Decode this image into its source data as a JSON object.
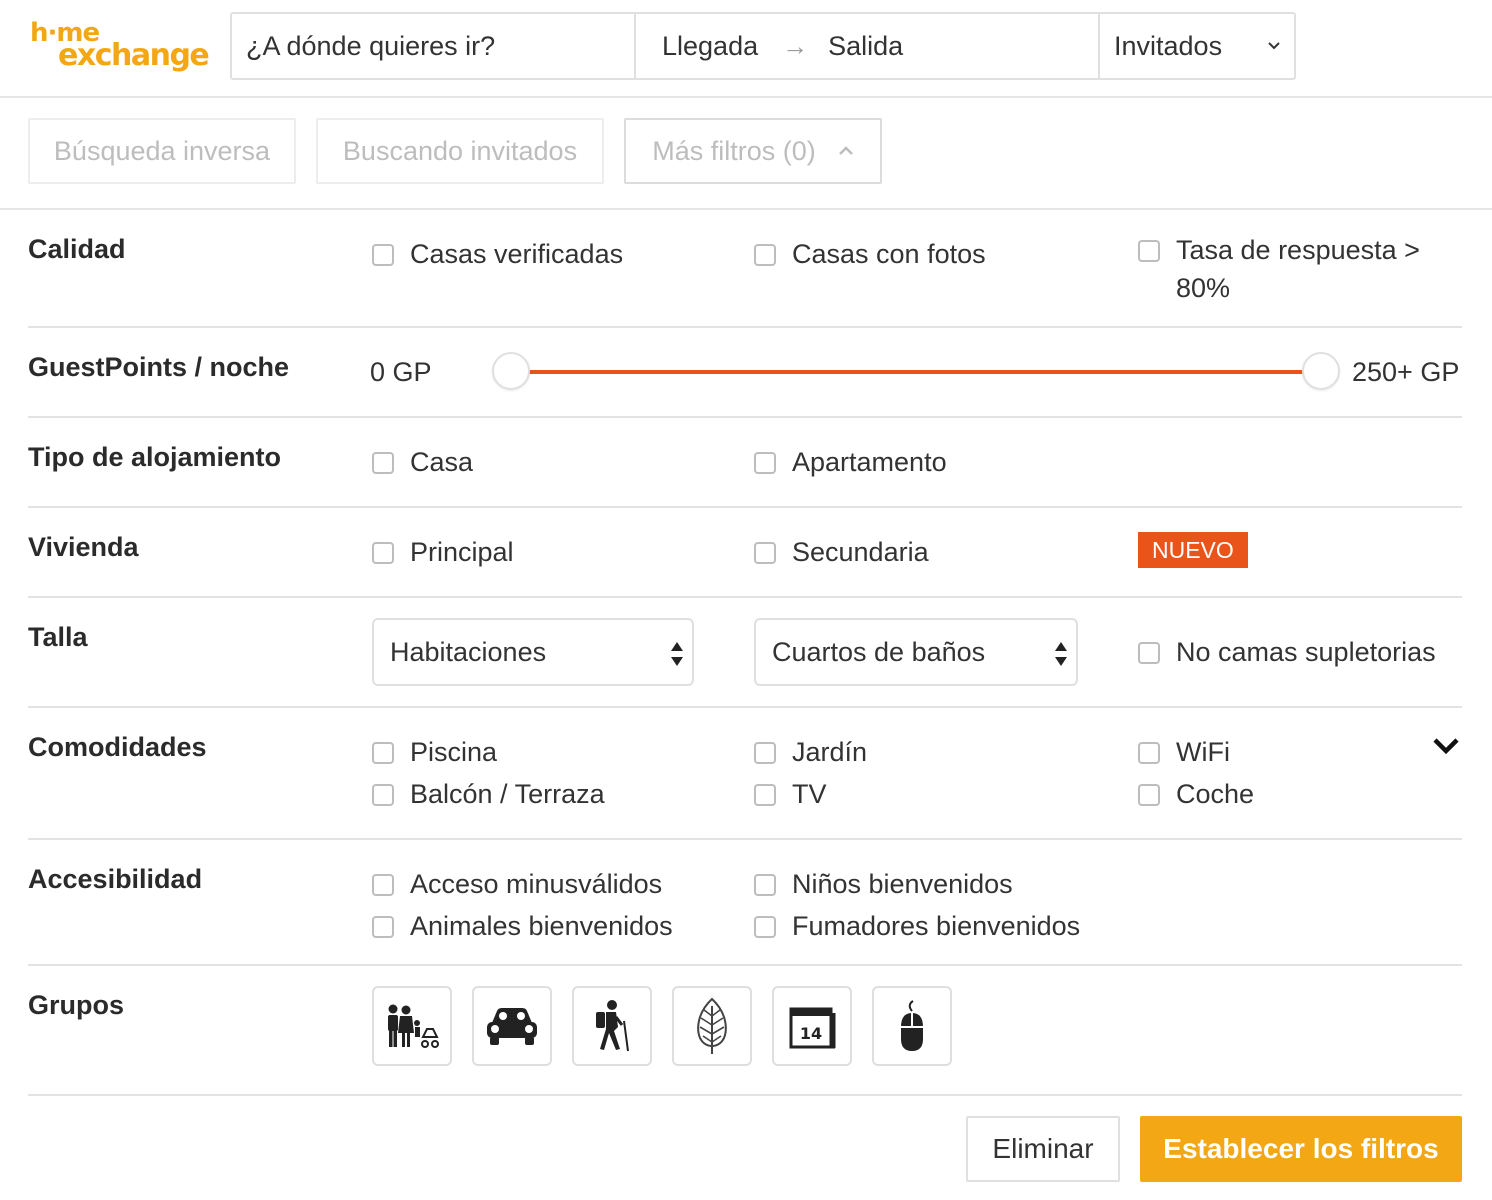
{
  "header": {
    "logo_line1": "h·me",
    "logo_line2": "exchange",
    "search_placeholder": "¿A dónde quieres ir?",
    "arrival": "Llegada",
    "arrow": "→",
    "departure": "Salida",
    "guests": "Invitados"
  },
  "quick_filters": {
    "reverse_search": "Búsqueda inversa",
    "looking_guests": "Buscando invitados",
    "more_filters": "Más filtros (0)"
  },
  "filters": {
    "quality": {
      "title": "Calidad",
      "options": [
        "Casas verificadas",
        "Casas con fotos",
        "Tasa de respuesta > 80%"
      ],
      "option3_line1": "Tasa de respuesta >",
      "option3_line2": "80%"
    },
    "guestpoints": {
      "title": "GuestPoints / noche",
      "min_label": "0 GP",
      "max_label": "250+ GP"
    },
    "accommodation_type": {
      "title": "Tipo de alojamiento",
      "options": [
        "Casa",
        "Apartamento"
      ]
    },
    "residence": {
      "title": "Vivienda",
      "options": [
        "Principal",
        "Secundaria"
      ],
      "badge": "NUEVO"
    },
    "size": {
      "title": "Talla",
      "bedrooms": "Habitaciones",
      "bathrooms": "Cuartos de baños",
      "no_extra_beds": "No camas supletorias"
    },
    "amenities": {
      "title": "Comodidades",
      "options": [
        "Piscina",
        "Jardín",
        "WiFi",
        "Balcón / Terraza",
        "TV",
        "Coche"
      ]
    },
    "accessibility": {
      "title": "Accesibilidad",
      "options": [
        "Acceso minusválidos",
        "Niños bienvenidos",
        "Animales bienvenidos",
        "Fumadores bienvenidos"
      ]
    },
    "groups": {
      "title": "Grupos",
      "icons": [
        "family-icon",
        "car-icon",
        "hiker-icon",
        "leaf-icon",
        "calendar-icon",
        "mouse-icon"
      ],
      "calendar_day": "14"
    }
  },
  "actions": {
    "clear": "Eliminar",
    "apply": "Establecer los filtros"
  },
  "colors": {
    "brand": "#f4a714",
    "accent": "#e8541a"
  }
}
